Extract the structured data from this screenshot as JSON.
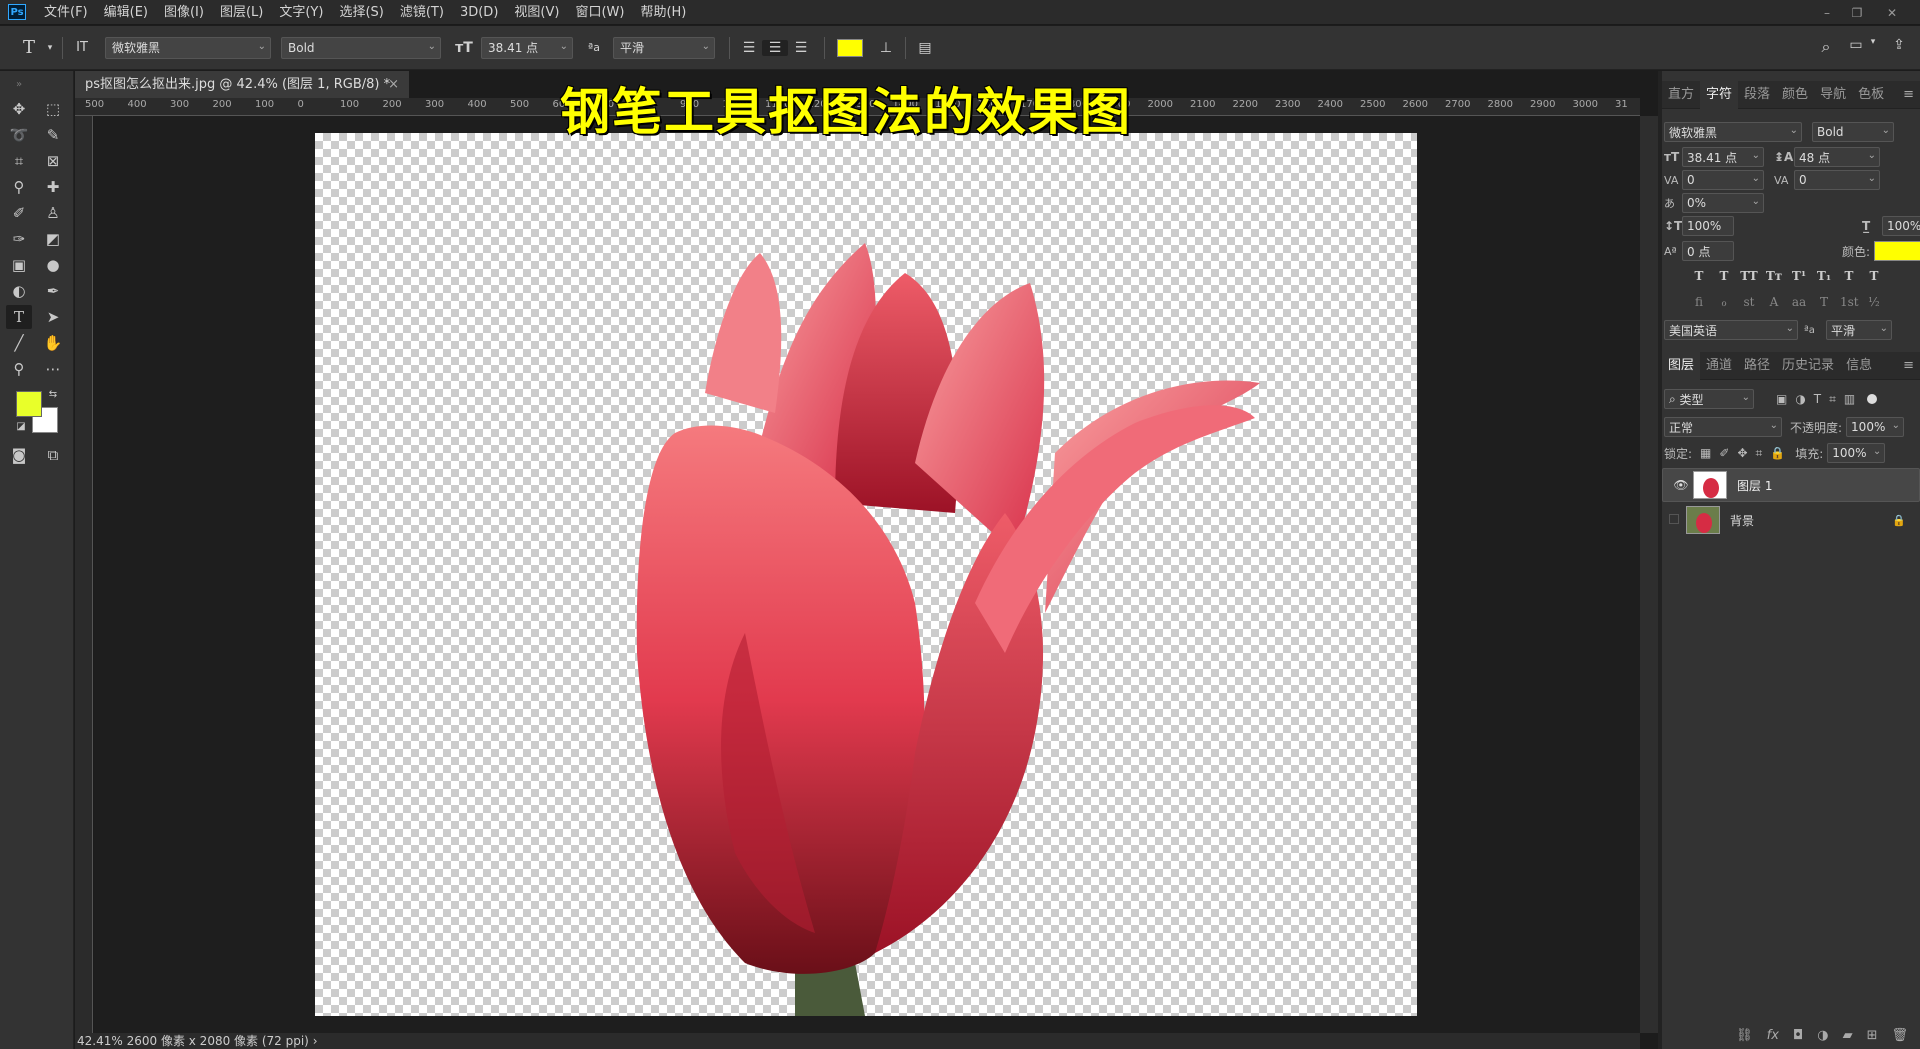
{
  "app": {
    "logo": "Ps"
  },
  "menu": [
    "文件(F)",
    "编辑(E)",
    "图像(I)",
    "图层(L)",
    "文字(Y)",
    "选择(S)",
    "滤镜(T)",
    "3D(D)",
    "视图(V)",
    "窗口(W)",
    "帮助(H)"
  ],
  "window_controls": {
    "minimize": "–",
    "restore": "❐",
    "close": "✕"
  },
  "options": {
    "tool_icon": "T",
    "font_family": "微软雅黑",
    "font_style": "Bold",
    "font_size": "38.41 点",
    "antialias": "平滑",
    "text_color": "#ffff00"
  },
  "document": {
    "tab_title": "ps抠图怎么抠出来.jpg @ 42.4% (图层 1, RGB/8) *",
    "close": "×",
    "ruler_labels": [
      "500",
      "400",
      "300",
      "200",
      "100",
      "0",
      "100",
      "200",
      "300",
      "400",
      "500",
      "600",
      "700",
      "800",
      "900",
      "1000",
      "1100",
      "1200",
      "1300",
      "1400",
      "1500",
      "1600",
      "1700",
      "1800",
      "1900",
      "2000",
      "2100",
      "2200",
      "2300",
      "2400",
      "2500",
      "2600",
      "2700",
      "2800",
      "2900",
      "3000",
      "31"
    ]
  },
  "headline": "钢笔工具抠图法的效果图",
  "status": {
    "zoom": "42.41%",
    "info": "2600 像素 x 2080 像素 (72 ppi)",
    "arrow": "›"
  },
  "character_panel": {
    "tabs": [
      "直方",
      "字符",
      "段落",
      "颜色",
      "导航",
      "色板"
    ],
    "active_tab": "字符",
    "font_family": "微软雅黑",
    "font_style": "Bold",
    "size": "38.41 点",
    "leading": "48 点",
    "kerning": "0",
    "tracking": "0",
    "tsume": "0%",
    "vscale": "100%",
    "hscale": "100%",
    "baseline": "0 点",
    "color_label": "颜色:",
    "color": "#ffff00",
    "language": "美国英语",
    "aa": "平滑",
    "format_buttons": [
      "T",
      "T",
      "TT",
      "Tт",
      "T¹",
      "T₁",
      "T",
      "T"
    ],
    "opentype_buttons": [
      "fi",
      "ℴ",
      "st",
      "A",
      "aa",
      "T",
      "1st",
      "½"
    ]
  },
  "layers_panel": {
    "tabs": [
      "图层",
      "通道",
      "路径",
      "历史记录",
      "信息"
    ],
    "active_tab": "图层",
    "filter": "类型",
    "blend_mode": "正常",
    "opacity_label": "不透明度:",
    "opacity": "100%",
    "lock_label": "锁定:",
    "fill_label": "填充:",
    "fill": "100%",
    "layers": [
      {
        "name": "图层 1",
        "visible": true,
        "selected": true,
        "locked": false
      },
      {
        "name": "背景",
        "visible": false,
        "selected": false,
        "locked": true
      }
    ]
  },
  "colors": {
    "foreground": "#e8ff2a",
    "background": "#ffffff"
  }
}
